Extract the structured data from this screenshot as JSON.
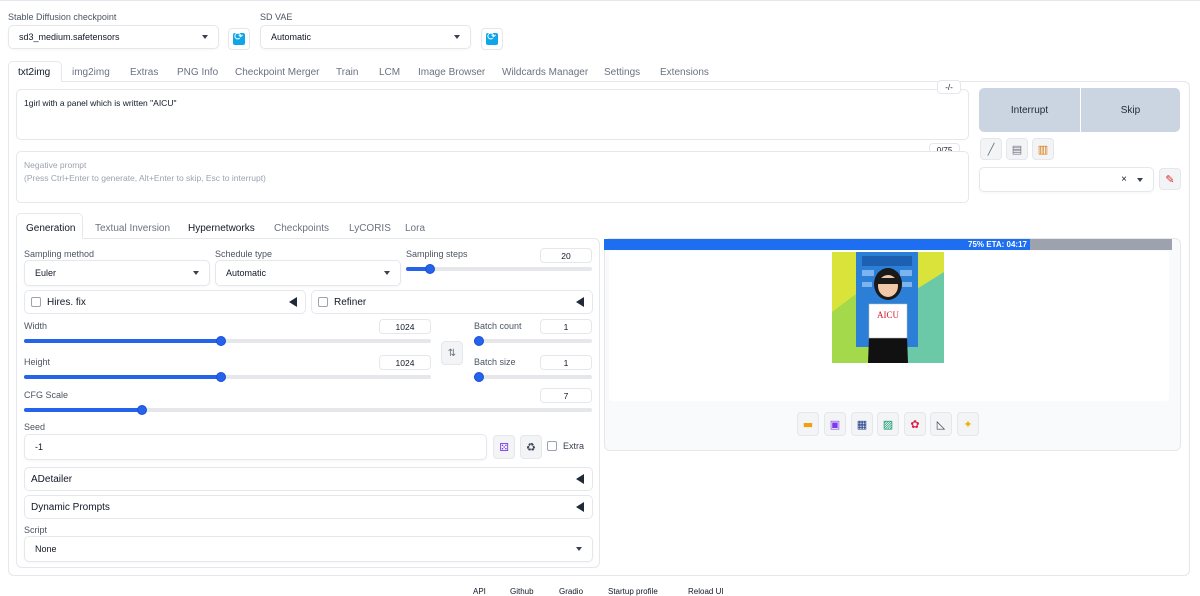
{
  "checkpoint": {
    "label": "Stable Diffusion checkpoint",
    "value": "sd3_medium.safetensors"
  },
  "vae": {
    "label": "SD VAE",
    "value": "Automatic"
  },
  "main_tabs": [
    "txt2img",
    "img2img",
    "Extras",
    "PNG Info",
    "Checkpoint Merger",
    "Train",
    "LCM",
    "Image Browser",
    "Wildcards Manager",
    "Settings",
    "Extensions"
  ],
  "active_tab": "txt2img",
  "prompt": {
    "value": "1girl with a panel which is written \"AICU\"",
    "toggle_label": "-/-",
    "token_count": "0/75"
  },
  "negative_prompt": {
    "label": "Negative prompt",
    "placeholder": "(Press Ctrl+Enter to generate, Alt+Enter to skip, Esc to interrupt)"
  },
  "buttons": {
    "interrupt": "Interrupt",
    "skip": "Skip"
  },
  "tool_icons": [
    "pencil-icon",
    "trash-icon",
    "clipboard-icon"
  ],
  "styles": {
    "clear": "×",
    "apply_icon": "brush-icon"
  },
  "sub_tabs": [
    "Generation",
    "Textual Inversion",
    "Hypernetworks",
    "Checkpoints",
    "LyCORIS",
    "Lora"
  ],
  "generation": {
    "sampling_method": {
      "label": "Sampling method",
      "value": "Euler"
    },
    "schedule_type": {
      "label": "Schedule type",
      "value": "Automatic"
    },
    "sampling_steps": {
      "label": "Sampling steps",
      "value": "20",
      "min": 1,
      "max": 150,
      "current": 20
    },
    "hires_fix": {
      "label": "Hires. fix"
    },
    "refiner": {
      "label": "Refiner"
    },
    "width": {
      "label": "Width",
      "value": "1024",
      "min": 64,
      "max": 2048,
      "current": 1024
    },
    "height": {
      "label": "Height",
      "value": "1024",
      "min": 64,
      "max": 2048,
      "current": 1024
    },
    "batch_count": {
      "label": "Batch count",
      "value": "1",
      "min": 1,
      "max": 100,
      "current": 1
    },
    "batch_size": {
      "label": "Batch size",
      "value": "1",
      "min": 1,
      "max": 8,
      "current": 1
    },
    "cfg_scale": {
      "label": "CFG Scale",
      "value": "7",
      "min": 1,
      "max": 30,
      "current": 7
    },
    "seed": {
      "label": "Seed",
      "value": "-1",
      "extra_label": "Extra"
    },
    "swap_icon": "swap-dimensions-icon"
  },
  "accordions": [
    "ADetailer",
    "Dynamic Prompts"
  ],
  "script": {
    "label": "Script",
    "value": "None"
  },
  "progress": {
    "text": "75% ETA: 04:17",
    "fraction": 0.75
  },
  "preview": {
    "panel_text": "AICU"
  },
  "output_icons": [
    "folder-icon",
    "save-icon",
    "zip-icon",
    "send-to-img2img-icon",
    "send-to-inpaint-icon",
    "send-to-extras-icon",
    "sparkle-icon"
  ],
  "footer": [
    "API",
    "Github",
    "Gradio",
    "Startup profile",
    "Reload UI"
  ]
}
